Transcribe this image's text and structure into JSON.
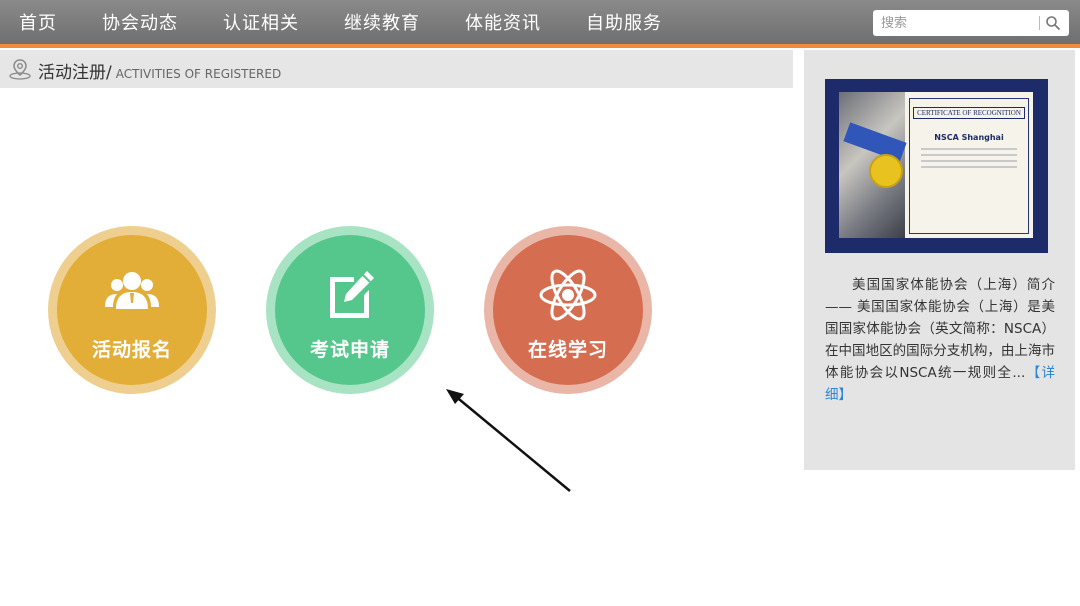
{
  "nav": {
    "items": [
      "首页",
      "协会动态",
      "认证相关",
      "继续教育",
      "体能资讯",
      "自助服务"
    ]
  },
  "search": {
    "placeholder": "搜索"
  },
  "breadcrumb": {
    "title": "活动注册/",
    "subtitle": "ACTIVITIES OF REGISTERED"
  },
  "actions": [
    {
      "label": "活动报名",
      "icon": "group-users-icon",
      "color": "#e2ae38"
    },
    {
      "label": "考试申请",
      "icon": "edit-form-icon",
      "color": "#56c78c"
    },
    {
      "label": "在线学习",
      "icon": "atom-icon",
      "color": "#d56e51"
    }
  ],
  "sidebar": {
    "certificate": {
      "heading": "CERTIFICATE OF RECOGNITION",
      "recipient": "NSCA Shanghai"
    },
    "text": "美国国家体能协会（上海）简介—— 美国国家体能协会（上海）是美国国家体能协会（英文简称：NSCA）在中国地区的国际分支机构，由上海市体能协会以NSCA统一规则全...",
    "link_label": "【详细】"
  },
  "colors": {
    "topbar": "#7d7d7d",
    "accent": "#f08a3c",
    "link": "#2b86d6"
  }
}
